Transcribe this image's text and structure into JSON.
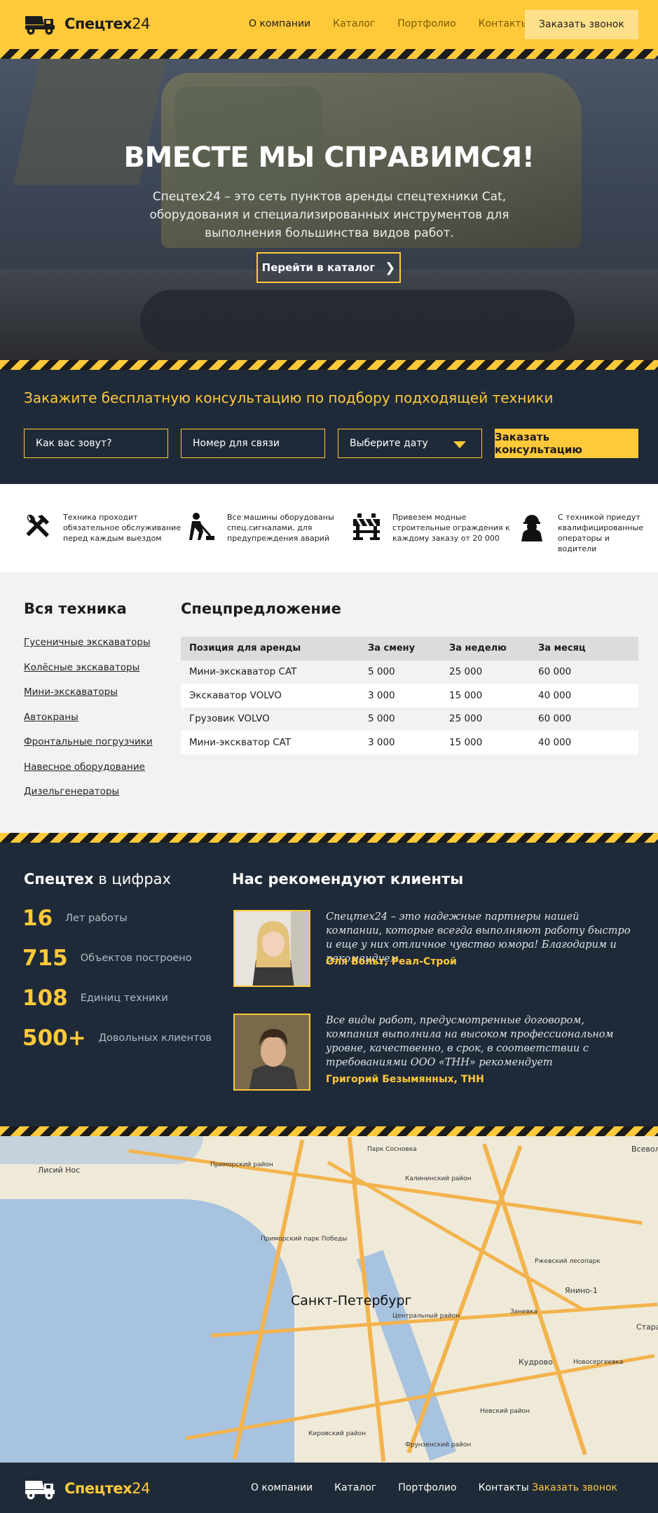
{
  "header": {
    "logo_text": "Спецтех",
    "logo_num": "24",
    "nav": [
      "О компании",
      "Каталог",
      "Портфолио",
      "Контакты"
    ],
    "call_button": "Заказать звонок"
  },
  "hero": {
    "title": "ВМЕСТЕ МЫ СПРАВИМСЯ!",
    "subtitle": "Спецтех24 – это сеть пунктов аренды спецтехники Cat, оборудования и специализированных инструментов для выполнения большинства видов работ.",
    "button": "Перейти в каталог"
  },
  "consult": {
    "title": "Закажите бесплатную консультацию по подбору подходящей техники",
    "name_placeholder": "Как вас зовут?",
    "phone_placeholder": "Номер для связи",
    "date_placeholder": "Выберите дату",
    "button": "Заказать консультацию"
  },
  "features": [
    {
      "icon": "tools-icon",
      "text": "Техника проходит обязательное обслуживание перед каждым выездом"
    },
    {
      "icon": "road-worker-icon",
      "text": "Все машины оборудованы спец.сигналами, для предупреждения аварий"
    },
    {
      "icon": "barrier-icon",
      "text": "Привезем модные строительные ограждения к каждому заказу от 20 000"
    },
    {
      "icon": "worker-helmet-icon",
      "text": "С техникой приедут квалифицированные операторы и водители"
    }
  ],
  "catalog": {
    "title": "Вся техника",
    "items": [
      "Гусеничные экскаваторы",
      "Колёсные экскаваторы",
      "Мини-экскаваторы",
      "Автокраны",
      "Фронтальные погрузчики",
      "Навесное оборудование",
      "Дизельгенераторы"
    ]
  },
  "offer": {
    "title": "Спецпредложение",
    "columns": [
      "Позиция для аренды",
      "За смену",
      "За неделю",
      "За месяц"
    ],
    "rows": [
      [
        "Мини-экскаватор CAT",
        "5 000",
        "25 000",
        "60 000"
      ],
      [
        "Экскаватор VOLVO",
        "3 000",
        "15 000",
        "40 000"
      ],
      [
        "Грузовик VOLVO",
        "5 000",
        "25 000",
        "60 000"
      ],
      [
        "Мини-экскватор CAT",
        "3 000",
        "15 000",
        "40 000"
      ]
    ]
  },
  "stats": {
    "title_bold": "Спецтех",
    "title_rest": " в цифрах",
    "items": [
      {
        "num": "16",
        "label": "Лет работы"
      },
      {
        "num": "715",
        "label": "Объектов построено"
      },
      {
        "num": "108",
        "label": "Единиц техники"
      },
      {
        "num": "500+",
        "label": "Довольных клиентов"
      }
    ]
  },
  "reviews": {
    "title": "Нас рекомендуют клиенты",
    "items": [
      {
        "text": "Спецтех24 – это надежные партнеры нашей компании, которые всегда выполняют работу быстро и еще у них отличное чувство юмора! Благодарим и рекомендуем.",
        "author": "Оля Вольт, Реал-Строй"
      },
      {
        "text": "Все виды работ, предусмотренные договором, компания выполнила на высоком профессиональном уровне, качественно, в срок, в соответствии с требованиями ООО «ТНН» рекомендует",
        "author": "Григорий Безымянных, ТНН"
      }
    ]
  },
  "map": {
    "city": "Санкт-Петербург",
    "labels": [
      "Лисий Нос",
      "Приморский район",
      "Калининский район",
      "Невский район",
      "Кировский район",
      "Фрунзенский район",
      "Кудрово",
      "Новосергеевка",
      "Янино-1",
      "Заневка",
      "Всеволожск",
      "Ржевский лесопарк",
      "Парк Сосновка",
      "Приморский парк Победы",
      "Центральный район",
      "Стара"
    ],
    "colors": {
      "water": "#a8c3df",
      "land": "#efe9d8",
      "road": "#f3b34c"
    }
  },
  "footer": {
    "logo_text": "Спецтех",
    "logo_num": "24",
    "nav": [
      "О компании",
      "Каталог",
      "Портфолио",
      "Контакты"
    ],
    "call": "Заказать звонок"
  },
  "colors": {
    "accent": "#ffc93a",
    "dark": "#1f2a38",
    "light": "#f2f2f2"
  }
}
